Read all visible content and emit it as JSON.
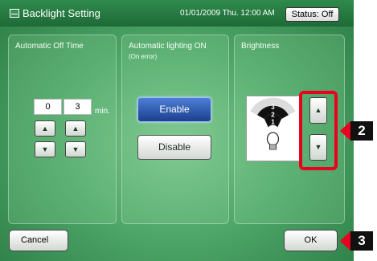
{
  "header": {
    "title": "Backlight Setting",
    "datetime": "01/01/2009 Thu. 12:00 AM",
    "status": "Status: Off"
  },
  "auto_off": {
    "title": "Automatic Off Time",
    "digit1": "0",
    "digit2": "3",
    "unit": "min.",
    "up_glyph": "▲",
    "down_glyph": "▼"
  },
  "auto_light": {
    "title": "Automatic lighting ON",
    "subtitle": "(On error)",
    "enable_label": "Enable",
    "disable_label": "Disable",
    "selected": "Enable"
  },
  "brightness": {
    "title": "Brightness",
    "levels": [
      "1",
      "2",
      "3"
    ],
    "current_level": 2,
    "up_glyph": "▲",
    "down_glyph": "▼"
  },
  "footer": {
    "cancel_label": "Cancel",
    "ok_label": "OK"
  },
  "callouts": {
    "brightness_buttons": "2",
    "ok_button": "3"
  },
  "colors": {
    "highlight": "#e8001e",
    "selected_button": "#2d5bb8",
    "background_green": "#4fa769"
  },
  "icons": {
    "title": "backlight-setting-icon",
    "brightness": "light-bulb-icon"
  }
}
